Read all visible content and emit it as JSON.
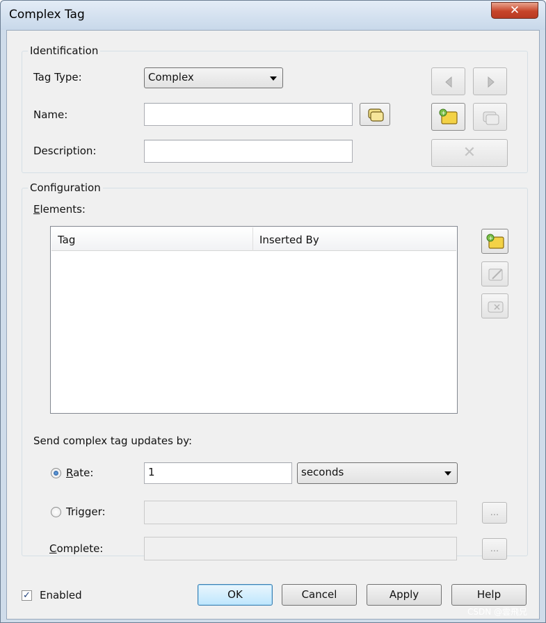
{
  "window": {
    "title": "Complex Tag",
    "close_glyph": "✕"
  },
  "identification": {
    "legend": "Identification",
    "tag_type_label": "Tag Type:",
    "tag_type_value": "Complex",
    "name_label": "Name:",
    "name_value": "",
    "description_label": "Description:",
    "description_value": "",
    "delete_glyph": "✕"
  },
  "configuration": {
    "legend": "Configuration",
    "elements_label_first": "E",
    "elements_label_rest": "lements:",
    "columns": [
      "Tag",
      "Inserted By"
    ],
    "rows": [],
    "send_label": "Send complex tag updates by:",
    "rate_label_first": "R",
    "rate_label_rest": "ate:",
    "rate_value": "1",
    "rate_unit": "seconds",
    "rate_selected": true,
    "trigger_label": "Trigger:",
    "trigger_value": "",
    "complete_label_first": "C",
    "complete_label_rest": "omplete:",
    "complete_value": "",
    "browse_glyph": "..."
  },
  "footer": {
    "enabled_label": "Enabled",
    "enabled_checked": true,
    "check_glyph": "✓",
    "ok_label": "OK",
    "cancel_label": "Cancel",
    "apply_label": "Apply",
    "help_label": "Help"
  },
  "watermark": "CSDN @雲飛兄"
}
